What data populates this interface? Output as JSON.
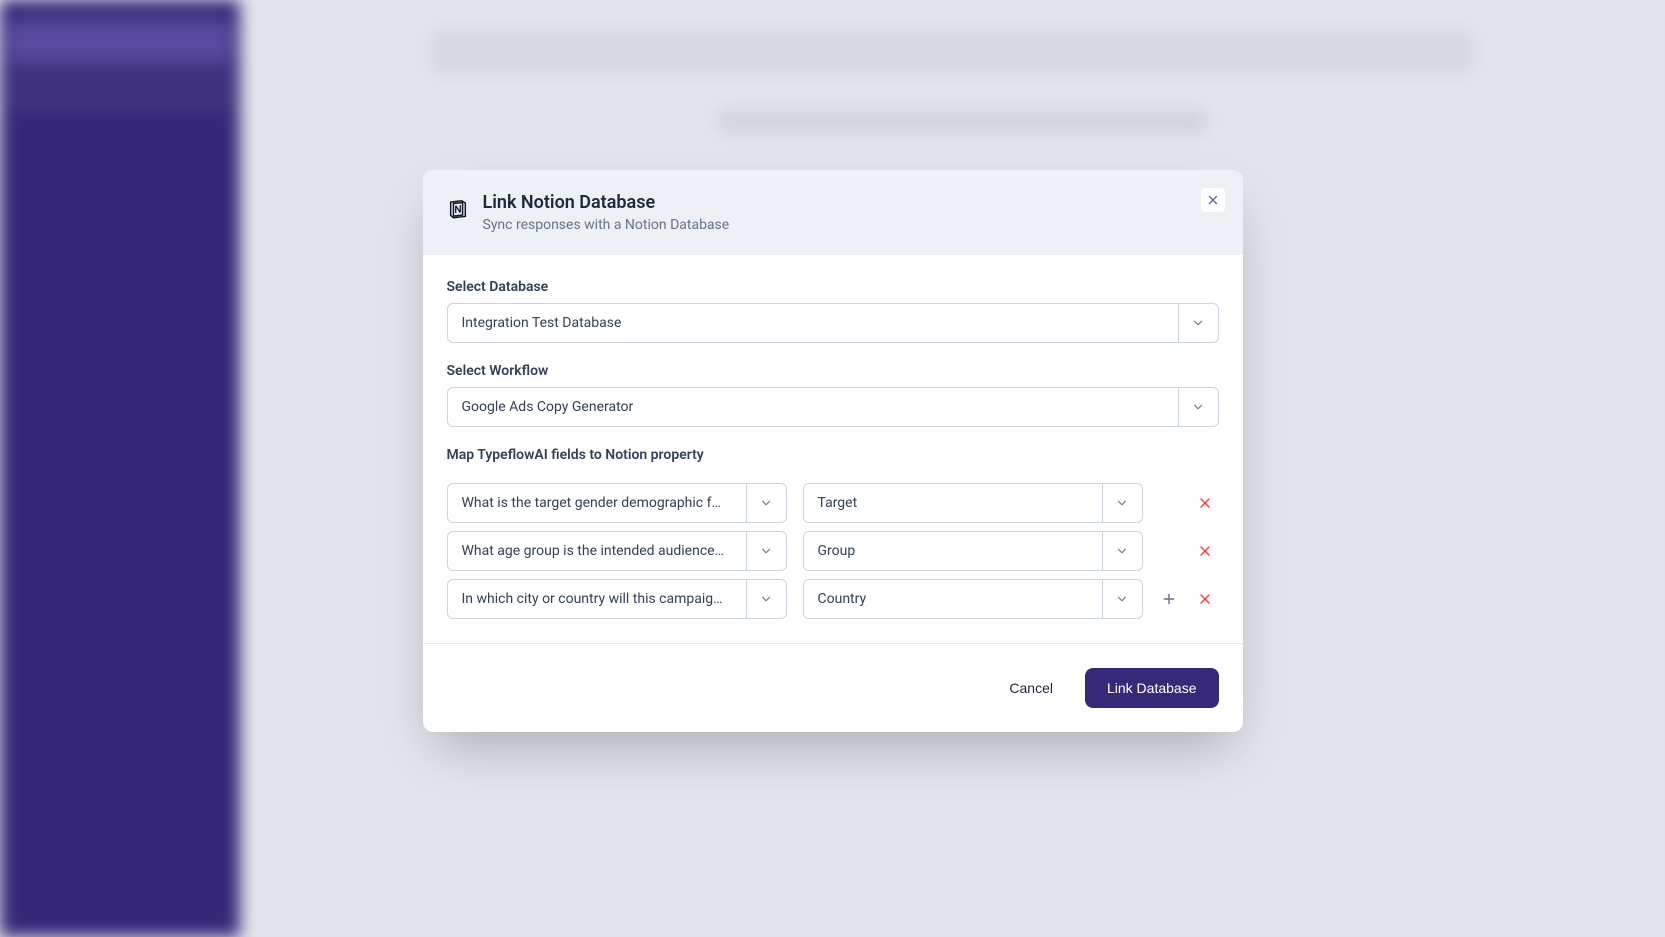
{
  "modal": {
    "title": "Link Notion Database",
    "subtitle": "Sync responses with a Notion Database",
    "database": {
      "label": "Select Database",
      "value": "Integration Test Database"
    },
    "workflow": {
      "label": "Select Workflow",
      "value": "Google Ads Copy Generator"
    },
    "mapping": {
      "label": "Map TypeflowAI fields to Notion property",
      "rows": [
        {
          "field": "What is the target gender demographic f…",
          "property": "Target"
        },
        {
          "field": "What age group is the intended audience…",
          "property": "Group"
        },
        {
          "field": "In which city or country will this campaig…",
          "property": "Country"
        }
      ]
    },
    "footer": {
      "cancel": "Cancel",
      "submit": "Link Database"
    }
  }
}
